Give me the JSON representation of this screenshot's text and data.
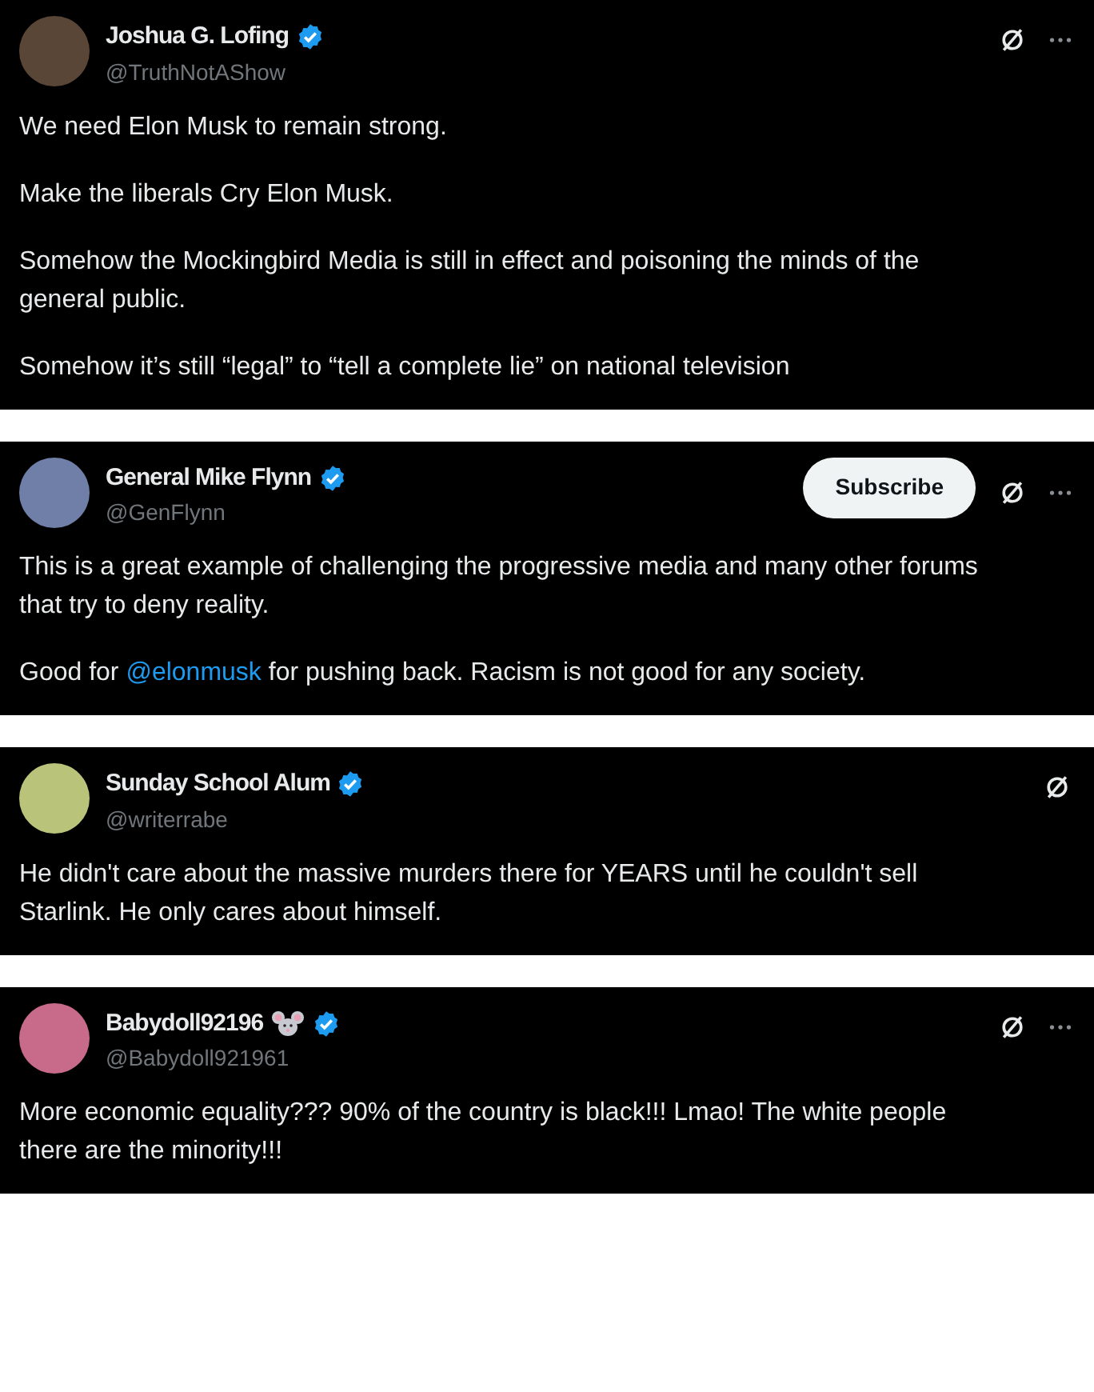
{
  "posts": [
    {
      "name": "Joshua G. Lofing",
      "verified": true,
      "handle": "@TruthNotAShow",
      "more_menu": true,
      "paragraphs": [
        [
          {
            "kind": "text",
            "text": "We need Elon Musk to remain strong."
          }
        ],
        [
          {
            "kind": "text",
            "text": "Make the liberals Cry Elon Musk."
          }
        ],
        [
          {
            "kind": "text",
            "text": "Somehow the Mockingbird Media is still in effect and poisoning the minds of the general public."
          }
        ],
        [
          {
            "kind": "text",
            "text": "Somehow it’s still “legal” to “tell a complete lie” on national television"
          }
        ]
      ]
    },
    {
      "name": "General Mike Flynn",
      "verified": true,
      "handle": "@GenFlynn",
      "subscribe": "Subscribe",
      "more_menu": true,
      "paragraphs": [
        [
          {
            "kind": "text",
            "text": "This is a great example of challenging the progressive media and many other forums that try to deny reality."
          }
        ],
        [
          {
            "kind": "text",
            "text": "Good for "
          },
          {
            "kind": "mention",
            "text": "@elonmusk"
          },
          {
            "kind": "text",
            "text": " for pushing back. Racism is not good for any society."
          }
        ]
      ]
    },
    {
      "name": "Sunday School Alum",
      "verified": true,
      "handle": "@writerrabe",
      "more_menu": false,
      "paragraphs": [
        [
          {
            "kind": "text",
            "text": "He didn't care about the massive murders there for YEARS until he couldn't sell Starlink. He only cares about himself."
          }
        ]
      ]
    },
    {
      "name": "Babydoll92196",
      "mouse_emoji": true,
      "verified": true,
      "handle": "@Babydoll921961",
      "more_menu": true,
      "paragraphs": [
        [
          {
            "kind": "text",
            "text": "More economic equality??? 90% of the country is black!!! Lmao! The white people there are the minority!!!"
          }
        ]
      ]
    }
  ]
}
